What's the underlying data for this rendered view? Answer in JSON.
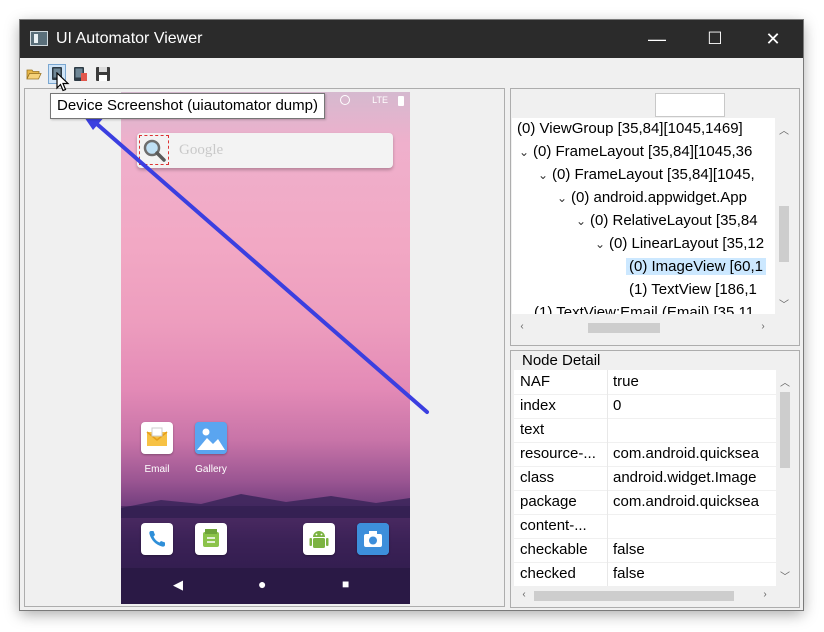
{
  "window": {
    "title": "UI Automator Viewer"
  },
  "window_controls": {
    "minimize": "—",
    "maximize": "☐",
    "close": "✕"
  },
  "toolbar": {
    "tooltip": "Device Screenshot (uiautomator dump)",
    "icons": [
      "open-folder-icon",
      "device-screenshot-icon",
      "device-screenshot-compressed-icon",
      "save-icon"
    ]
  },
  "phone": {
    "status": "LTE",
    "search_hint": "Google",
    "apps": [
      {
        "label": "Email",
        "icon": "email-app-icon"
      },
      {
        "label": "Gallery",
        "icon": "gallery-app-icon"
      }
    ],
    "dock": [
      "phone-app-icon",
      "messaging-app-icon",
      "android-app-icon",
      "camera-app-icon"
    ],
    "nav": {
      "back": "◀",
      "home": "●",
      "recents": "■"
    }
  },
  "tree": {
    "nodes": [
      {
        "text": "(0) ViewGroup [35,84][1045,1469]",
        "toggle": ""
      },
      {
        "text": "(0) FrameLayout [35,84][1045,36",
        "toggle": "⌄"
      },
      {
        "text": "(0) FrameLayout [35,84][1045,",
        "toggle": "⌄"
      },
      {
        "text": "(0) android.appwidget.App",
        "toggle": "⌄"
      },
      {
        "text": "(0) RelativeLayout [35,84",
        "toggle": "⌄"
      },
      {
        "text": "(0) LinearLayout [35,12",
        "toggle": "⌄"
      },
      {
        "text": "(0) ImageView [60,1",
        "toggle": "",
        "selected": true
      },
      {
        "text": "(1) TextView [186,1",
        "toggle": ""
      },
      {
        "text": "(1) TextView:Email (Email) [35,11",
        "toggle": ""
      }
    ]
  },
  "node_detail": {
    "title": "Node Detail",
    "rows": [
      {
        "key": "NAF",
        "value": "true"
      },
      {
        "key": "index",
        "value": "0"
      },
      {
        "key": "text",
        "value": ""
      },
      {
        "key": "resource-...",
        "value": "com.android.quicksea"
      },
      {
        "key": "class",
        "value": "android.widget.Image"
      },
      {
        "key": "package",
        "value": "com.android.quicksea"
      },
      {
        "key": "content-...",
        "value": ""
      },
      {
        "key": "checkable",
        "value": "false"
      },
      {
        "key": "checked",
        "value": "false"
      }
    ]
  },
  "colors": {
    "titlebar": "#2b2b2b",
    "selection": "#cce8ff",
    "annotation_arrow": "#3b3fe0"
  }
}
